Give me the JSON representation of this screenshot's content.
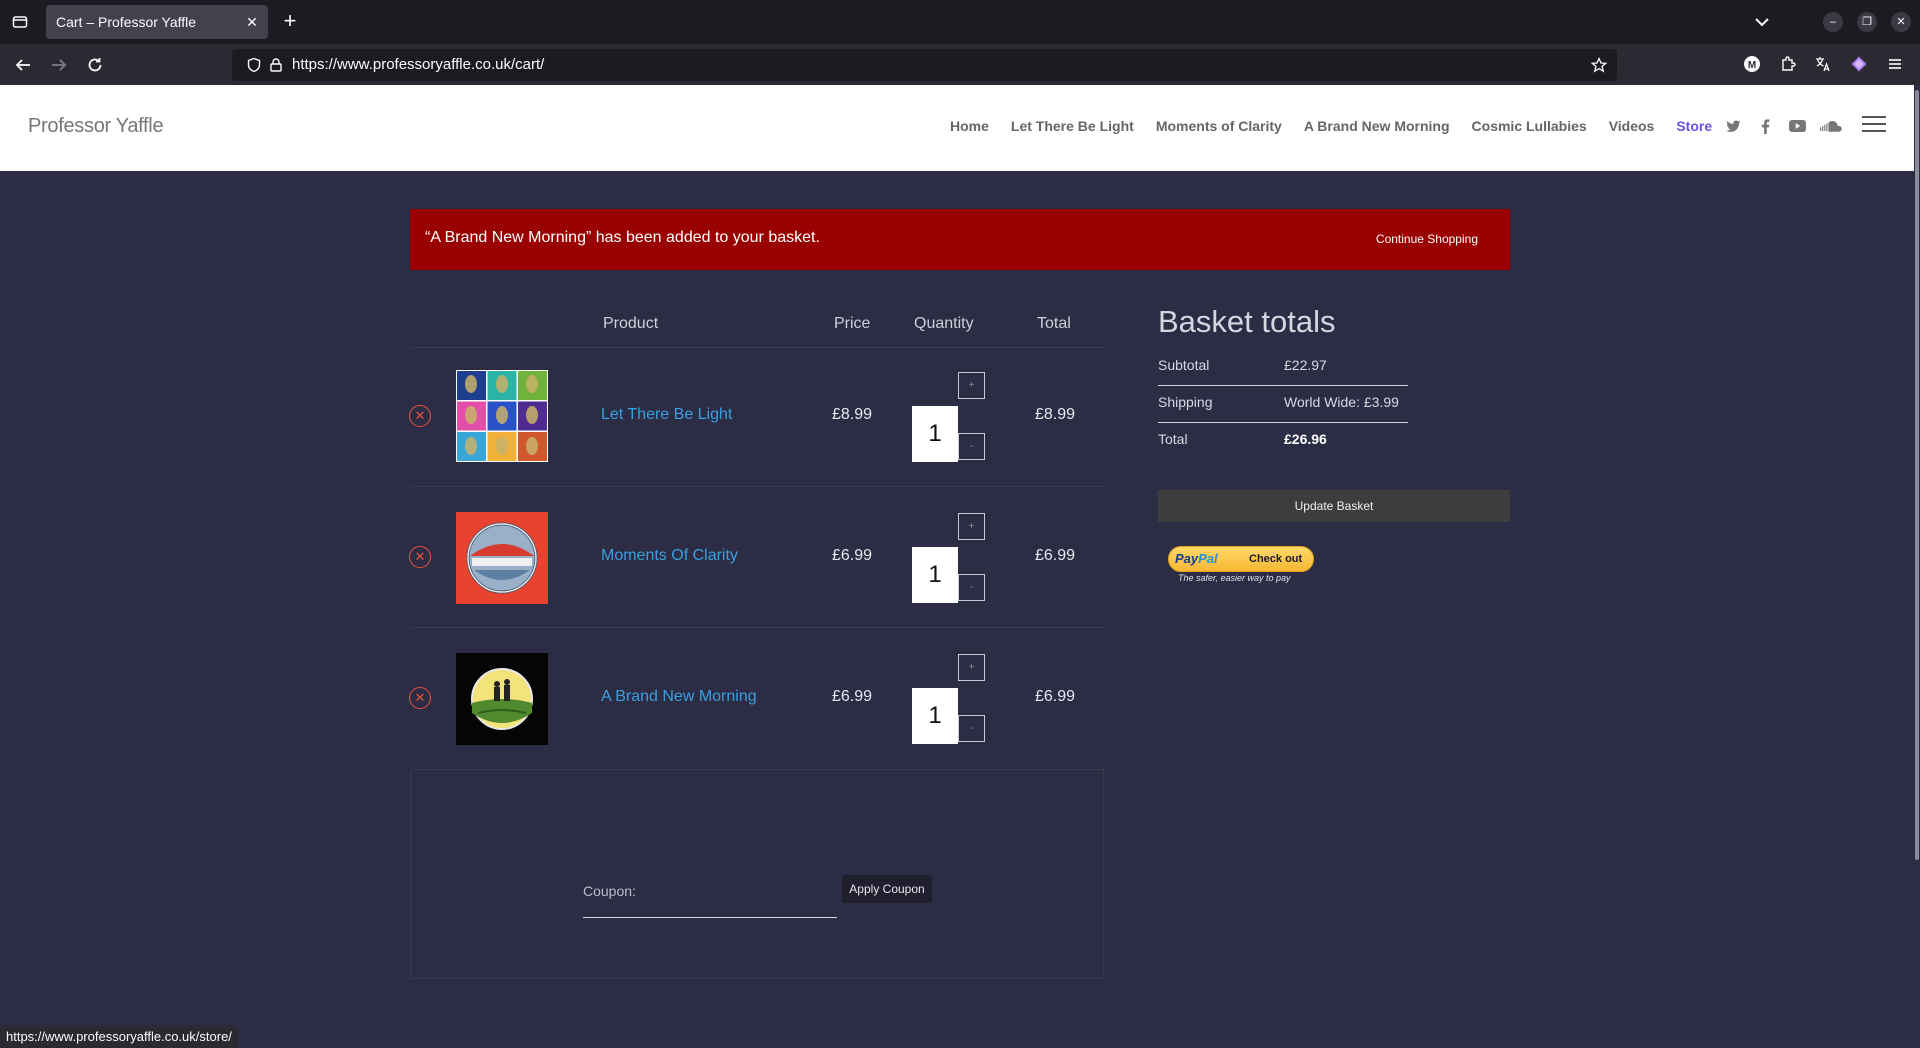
{
  "browser": {
    "tab_title": "Cart – Professor Yaffle",
    "url": "https://www.professoryaffle.co.uk/cart/",
    "status_url": "https://www.professoryaffle.co.uk/store/",
    "extensions": [
      "m-extension-icon",
      "puzzle-icon",
      "translate-icon",
      "gem-icon"
    ]
  },
  "site": {
    "logo": "Professor Yaffle",
    "menu": [
      {
        "label": "Home"
      },
      {
        "label": "Let There Be Light"
      },
      {
        "label": "Moments of Clarity"
      },
      {
        "label": "A Brand New Morning"
      },
      {
        "label": "Cosmic Lullabies"
      },
      {
        "label": "Videos"
      },
      {
        "label": "Store",
        "active": true
      }
    ],
    "socials": [
      "twitter-icon",
      "facebook-icon",
      "youtube-icon",
      "soundcloud-icon"
    ]
  },
  "notice": {
    "message": "“A Brand New Morning” has been added to your basket.",
    "button": "Continue Shopping"
  },
  "cart": {
    "headers": {
      "product": "Product",
      "price": "Price",
      "quantity": "Quantity",
      "total": "Total"
    },
    "items": [
      {
        "name": "Let There Be Light",
        "price": "£8.99",
        "qty": "1",
        "total": "£8.99",
        "plus": "+",
        "minus": "-"
      },
      {
        "name": "Moments Of Clarity",
        "price": "£6.99",
        "qty": "1",
        "total": "£6.99",
        "plus": "+",
        "minus": "-"
      },
      {
        "name": "A Brand New Morning",
        "price": "£6.99",
        "qty": "1",
        "total": "£6.99",
        "plus": "+",
        "minus": "-"
      }
    ],
    "coupon_label": "Coupon:",
    "coupon_value": "",
    "coupon_button": "Apply Coupon"
  },
  "totals": {
    "title": "Basket totals",
    "subtotal_label": "Subtotal",
    "subtotal": "£22.97",
    "shipping_label": "Shipping",
    "shipping": "World Wide: £3.99",
    "total_label": "Total",
    "total": "£26.96",
    "update_button": "Update Basket",
    "paypal_pay": "Pay",
    "paypal_pal": "Pal",
    "paypal_checkout": "Check out",
    "paypal_tagline": "The safer, easier way to pay"
  },
  "colors": {
    "page_bg": "#2c2c44",
    "notice_bg": "#990000",
    "link": "#3a9fe0",
    "active_menu": "#6d4fe8",
    "remove": "#e8533f"
  }
}
